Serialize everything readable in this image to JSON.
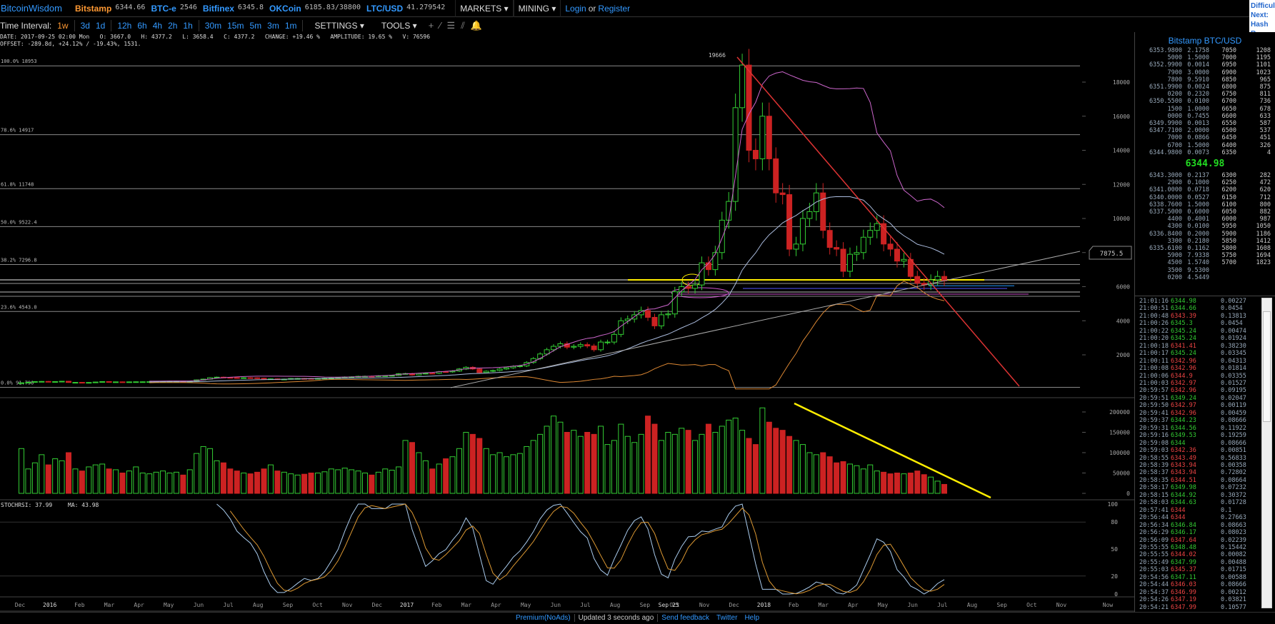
{
  "topbar": {
    "brand": "BitcoinWisdom",
    "tickers": [
      {
        "name": "Bitstamp",
        "value": "6344.66",
        "selected": true
      },
      {
        "name": "BTC-e",
        "value": "2546"
      },
      {
        "name": "Bitfinex",
        "value": "6345.8"
      },
      {
        "name": "OKCoin",
        "value": "6185.83/38800"
      },
      {
        "name": "LTC/USD",
        "value": "41.279542"
      }
    ],
    "markets": "MARKETS ▾",
    "mining": "MINING ▾",
    "login": "Login",
    "or": "or",
    "register": "Register"
  },
  "difficulty": {
    "l1": "Difficul",
    "l2": "Next:",
    "l3": "Hash R"
  },
  "toolbar": {
    "label": "Time Interval:",
    "intervals": [
      "1w",
      "3d",
      "1d",
      "12h",
      "6h",
      "4h",
      "2h",
      "1h",
      "30m",
      "15m",
      "5m",
      "3m",
      "1m"
    ],
    "selected": "1w",
    "settings": "SETTINGS ▾",
    "tools": "TOOLS ▾",
    "tool_icons": [
      "+",
      "⁄",
      "☰",
      "⫽",
      "🔔"
    ]
  },
  "info": {
    "line1": "DATE: 2017-09-25 02:00 Mon   O: 3667.0   H: 4377.2   L: 3658.4   C: 4377.2   CHANGE: +19.46 %   AMPLITUDE: 19.65 %   V: 76596",
    "line2": "OFFSET: -289.8d, +24.12% / -19.43%, 1531."
  },
  "chart_data": {
    "type": "candlestick",
    "interval": "1w",
    "price_ticks": [
      2000,
      4000,
      6000,
      8000,
      10000,
      12000,
      14000,
      16000,
      18000
    ],
    "volume_ticks": [
      0,
      50000,
      100000,
      150000,
      200000
    ],
    "stoch_ticks": [
      0,
      20,
      50,
      80,
      100
    ],
    "time_labels": [
      "Dec",
      "2016",
      "Feb",
      "Mar",
      "Apr",
      "May",
      "Jun",
      "Jul",
      "Aug",
      "Sep",
      "Oct",
      "Nov",
      "Dec",
      "2017",
      "Feb",
      "Mar",
      "Apr",
      "May",
      "Jun",
      "Jul",
      "Aug",
      "Sep",
      "Oct",
      "Nov",
      "Dec",
      "2018",
      "Feb",
      "Mar",
      "Apr",
      "May",
      "Jun",
      "Jul",
      "Aug",
      "Sep",
      "Oct",
      "Nov"
    ],
    "cursor_label": "Sep 25",
    "now_label": "Now",
    "high_label": "19666",
    "price_marker": "7875.5",
    "fib_levels": [
      {
        "label": "100.0% 18953",
        "price": 18953
      },
      {
        "label": "78.6% 14917",
        "price": 14917
      },
      {
        "label": "61.8% 11748",
        "price": 11748
      },
      {
        "label": "50.0% 9522.4",
        "price": 9522.4
      },
      {
        "label": "38.2% 7296.8",
        "price": 7296.8
      },
      {
        "label": "23.6% 4543.0",
        "price": 4543.0
      },
      {
        "label": "0.0% 91.790",
        "price": 91.79
      }
    ],
    "stoch_label": "STOCHRSI: 37.99",
    "ma_label": "MA: 43.98",
    "closes": [
      360,
      390,
      430,
      440,
      430,
      430,
      450,
      380,
      385,
      375,
      380,
      405,
      430,
      410,
      415,
      410,
      415,
      420,
      420,
      425,
      430,
      450,
      455,
      455,
      445,
      455,
      530,
      575,
      660,
      690,
      670,
      660,
      650,
      655,
      650,
      625,
      580,
      590,
      575,
      575,
      610,
      610,
      608,
      600,
      615,
      630,
      640,
      655,
      700,
      710,
      740,
      745,
      735,
      770,
      770,
      790,
      890,
      900,
      820,
      900,
      920,
      915,
      1010,
      1000,
      1050,
      1170,
      1270,
      1170,
      960,
      1040,
      1080,
      1170,
      1240,
      1320,
      1350,
      1550,
      1780,
      2050,
      2300,
      2500,
      2650,
      2450,
      2500,
      2600,
      2520,
      2300,
      2750,
      2750,
      3200,
      4000,
      4100,
      4350,
      4600,
      4200,
      3700,
      4350,
      4400,
      5700,
      6000,
      5900,
      6100,
      7400,
      7000,
      8000,
      9900,
      11000,
      16500,
      19000,
      14000,
      13500,
      16000,
      13500,
      11500,
      11400,
      8200,
      8500,
      10000,
      10400,
      11500,
      9300,
      8300,
      8200,
      6900,
      7900,
      8000,
      8900,
      9300,
      9700,
      8500,
      8200,
      7500,
      7600,
      6600,
      6200,
      6100,
      6400,
      6600,
      6344.98
    ],
    "volumes": [
      110000,
      60000,
      75000,
      95000,
      70000,
      85000,
      80000,
      100000,
      60000,
      55000,
      65000,
      70000,
      72000,
      60000,
      58000,
      50000,
      55000,
      65000,
      50000,
      48000,
      52000,
      55000,
      50000,
      52000,
      45000,
      58000,
      98000,
      115000,
      110000,
      80000,
      75000,
      60000,
      55000,
      50000,
      48000,
      52000,
      60000,
      70000,
      55000,
      52000,
      48000,
      45000,
      47000,
      50000,
      50000,
      53000,
      60000,
      58000,
      62000,
      58000,
      55000,
      50000,
      45000,
      52000,
      60000,
      57000,
      65000,
      130000,
      125000,
      100000,
      80000,
      60000,
      72000,
      85000,
      90000,
      110000,
      150000,
      145000,
      135000,
      110000,
      95000,
      100000,
      90000,
      95000,
      98000,
      115000,
      130000,
      145000,
      165000,
      190000,
      175000,
      150000,
      155000,
      140000,
      150000,
      145000,
      165000,
      120000,
      130000,
      170000,
      140000,
      125000,
      145000,
      190000,
      170000,
      130000,
      150000,
      145000,
      160000,
      155000,
      130000,
      145000,
      170000,
      150000,
      165000,
      180000,
      185000,
      155000,
      135000,
      120000,
      210000,
      175000,
      160000,
      155000,
      140000,
      130000,
      120000,
      100000,
      95000,
      100000,
      90000,
      75000,
      78000,
      72000,
      68000,
      60000,
      70000,
      55000,
      52000,
      48000,
      50000,
      48000,
      50000,
      55000,
      46000,
      40000,
      30000,
      22000
    ],
    "colors": {
      "up": "#33cc33",
      "down": "#cc2222",
      "bb_upper": "#cc66cc",
      "bb_mid": "#aabbdd",
      "bb_lower": "#dd8833",
      "stoch_k": "#aaccee",
      "stoch_d": "#dd9933",
      "trend_red": "#dd3333",
      "trend_yellow": "#ffee00"
    }
  },
  "orderbook": {
    "title": "Bitstamp BTC/USD",
    "asks": [
      [
        "6353.9800",
        "2.1758",
        "7050",
        "1208"
      ],
      [
        "5000",
        "1.5000",
        "7000",
        "1195"
      ],
      [
        "6352.9900",
        "0.0014",
        "6950",
        "1101"
      ],
      [
        "7900",
        "3.0000",
        "6900",
        "1023"
      ],
      [
        "7800",
        "9.5910",
        "6850",
        "965"
      ],
      [
        "6351.9900",
        "0.0024",
        "6800",
        "875"
      ],
      [
        "0200",
        "0.2320",
        "6750",
        "811"
      ],
      [
        "6350.5500",
        "0.0100",
        "6700",
        "736"
      ],
      [
        "1500",
        "1.0000",
        "6650",
        "678"
      ],
      [
        "0000",
        "0.7455",
        "6600",
        "633"
      ],
      [
        "6349.9900",
        "0.0013",
        "6550",
        "587"
      ],
      [
        "6347.7100",
        "2.0000",
        "6500",
        "537"
      ],
      [
        "7000",
        "0.0866",
        "6450",
        "451"
      ],
      [
        "6700",
        "1.5000",
        "6400",
        "326"
      ],
      [
        "6344.9800",
        "0.0073",
        "6350",
        "4"
      ]
    ],
    "last": "6344.98",
    "bids": [
      [
        "6343.3000",
        "0.2137",
        "6300",
        "282"
      ],
      [
        "2900",
        "0.1000",
        "6250",
        "472"
      ],
      [
        "6341.0000",
        "0.0718",
        "6200",
        "620"
      ],
      [
        "6340.0000",
        "0.0527",
        "6150",
        "712"
      ],
      [
        "6338.7600",
        "1.5000",
        "6100",
        "800"
      ],
      [
        "6337.5000",
        "0.6000",
        "6050",
        "882"
      ],
      [
        "4400",
        "0.4001",
        "6000",
        "987"
      ],
      [
        "4300",
        "0.0100",
        "5950",
        "1050"
      ],
      [
        "6336.8400",
        "0.2000",
        "5900",
        "1186"
      ],
      [
        "3300",
        "0.2180",
        "5850",
        "1412"
      ],
      [
        "6335.6100",
        "0.1162",
        "5800",
        "1608"
      ],
      [
        "5900",
        "7.9338",
        "5750",
        "1694"
      ],
      [
        "4500",
        "1.5740",
        "5700",
        "1823"
      ],
      [
        "3500",
        "9.5300",
        "",
        ""
      ],
      [
        "0200",
        "4.5449",
        "",
        ""
      ]
    ]
  },
  "trades": [
    [
      "21:01:16",
      "6344.98",
      "up",
      "0.00227"
    ],
    [
      "21:00:51",
      "6344.66",
      "up",
      "0.0454"
    ],
    [
      "21:00:48",
      "6343.39",
      "dn",
      "0.13813"
    ],
    [
      "21:00:26",
      "6345.3",
      "up",
      "0.0454"
    ],
    [
      "21:00:22",
      "6345.24",
      "up",
      "0.00474"
    ],
    [
      "21:00:20",
      "6345.24",
      "up",
      "0.01924"
    ],
    [
      "21:00:18",
      "6341.41",
      "dn",
      "0.38230"
    ],
    [
      "21:00:17",
      "6345.24",
      "up",
      "0.03345"
    ],
    [
      "21:00:11",
      "6342.96",
      "dn",
      "0.04313"
    ],
    [
      "21:00:08",
      "6342.96",
      "dn",
      "0.01814"
    ],
    [
      "21:00:06",
      "6344.9",
      "dn",
      "0.03355"
    ],
    [
      "21:00:03",
      "6342.97",
      "dn",
      "0.01527"
    ],
    [
      "20:59:57",
      "6342.96",
      "dn",
      "0.09195"
    ],
    [
      "20:59:51",
      "6349.24",
      "up",
      "0.02047"
    ],
    [
      "20:59:50",
      "6342.97",
      "dn",
      "0.00119"
    ],
    [
      "20:59:41",
      "6342.96",
      "dn",
      "0.00459"
    ],
    [
      "20:59:37",
      "6344.23",
      "up",
      "0.08666"
    ],
    [
      "20:59:31",
      "6344.56",
      "up",
      "0.11922"
    ],
    [
      "20:59:16",
      "6349.53",
      "up",
      "0.19259"
    ],
    [
      "20:59:08",
      "6344",
      "up",
      "0.08666"
    ],
    [
      "20:59:03",
      "6342.36",
      "dn",
      "0.00851"
    ],
    [
      "20:58:55",
      "6343.49",
      "dn",
      "0.56833"
    ],
    [
      "20:58:39",
      "6343.94",
      "dn",
      "0.00358"
    ],
    [
      "20:58:37",
      "6343.94",
      "dn",
      "0.72802"
    ],
    [
      "20:58:35",
      "6344.51",
      "dn",
      "0.08664"
    ],
    [
      "20:58:17",
      "6349.98",
      "up",
      "0.07232"
    ],
    [
      "20:58:15",
      "6344.92",
      "up",
      "0.30372"
    ],
    [
      "20:58:03",
      "6344.63",
      "up",
      "0.01728"
    ],
    [
      "20:57:41",
      "6344",
      "dn",
      "0.1"
    ],
    [
      "20:56:44",
      "6344",
      "dn",
      "0.27663"
    ],
    [
      "20:56:34",
      "6346.84",
      "up",
      "0.08663"
    ],
    [
      "20:56:29",
      "6346.17",
      "up",
      "0.08023"
    ],
    [
      "20:56:09",
      "6347.64",
      "dn",
      "0.02239"
    ],
    [
      "20:55:55",
      "6348.48",
      "up",
      "0.15442"
    ],
    [
      "20:55:55",
      "6344.02",
      "dn",
      "0.00082"
    ],
    [
      "20:55:49",
      "6347.99",
      "up",
      "0.00488"
    ],
    [
      "20:55:03",
      "6345.37",
      "dn",
      "0.01715"
    ],
    [
      "20:54:56",
      "6347.11",
      "up",
      "0.00588"
    ],
    [
      "20:54:44",
      "6346.03",
      "dn",
      "0.08666"
    ],
    [
      "20:54:37",
      "6346.99",
      "dn",
      "0.00212"
    ],
    [
      "20:54:26",
      "6347.19",
      "dn",
      "0.03821"
    ],
    [
      "20:54:21",
      "6347.99",
      "dn",
      "0.10577"
    ]
  ],
  "footer": {
    "premium": "Premium(NoAds)",
    "updated": "Updated 3 seconds ago",
    "feedback": "Send feedback",
    "twitter": "Twitter",
    "help": "Help"
  }
}
